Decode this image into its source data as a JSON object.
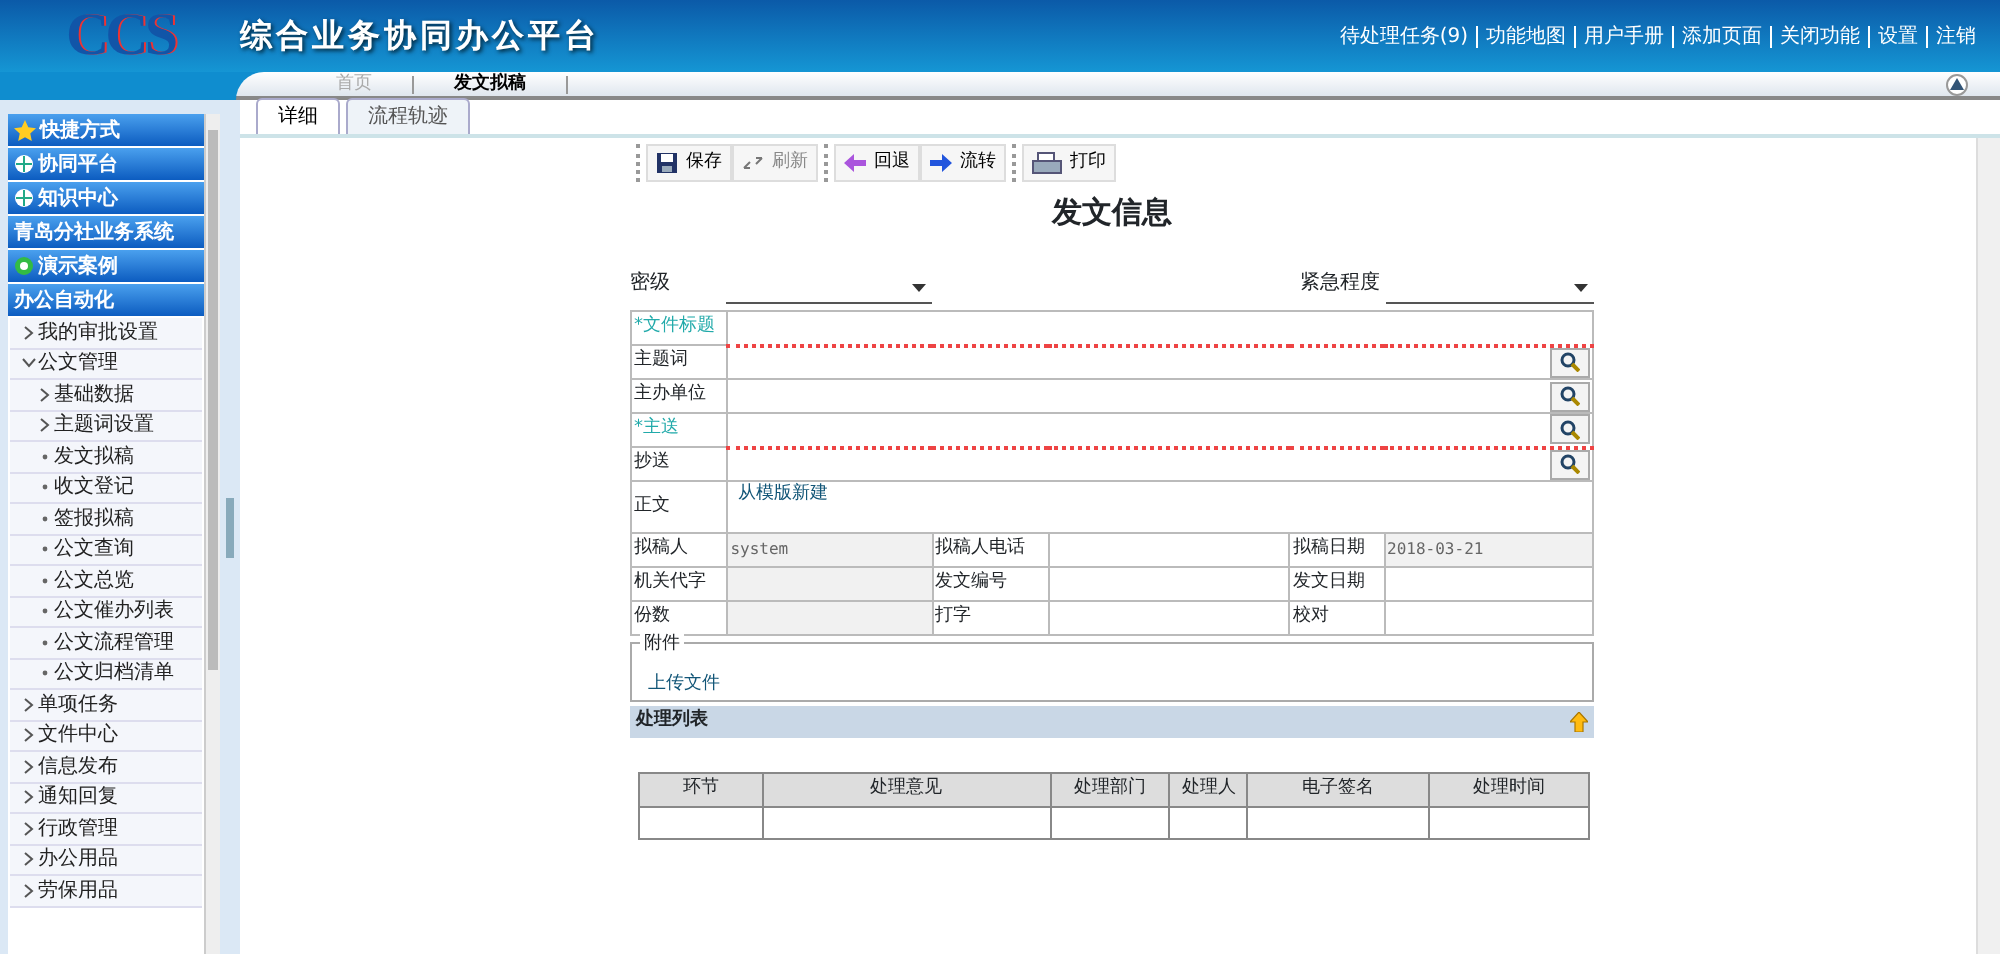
{
  "header": {
    "logo": "CCS",
    "title": "综合业务协同办公平台",
    "links": [
      "待处理任务(9)",
      "功能地图",
      "用户手册",
      "添加页面",
      "关闭功能",
      "设置",
      "注销"
    ]
  },
  "page_tabs": [
    {
      "label": "首页",
      "selected": false
    },
    {
      "label": "发文拟稿",
      "selected": true
    }
  ],
  "sidebar": {
    "sections": [
      {
        "label": "快捷方式"
      },
      {
        "label": "协同平台"
      },
      {
        "label": "知识中心"
      },
      {
        "label": "青岛分社业务系统"
      },
      {
        "label": "演示案例"
      },
      {
        "label": "办公自动化"
      }
    ],
    "items": [
      {
        "label": "我的审批设置",
        "expanded": false
      },
      {
        "label": "公文管理",
        "expanded": true,
        "children": [
          {
            "label": "基础数据",
            "expanded": false
          },
          {
            "label": "主题词设置",
            "expanded": false
          },
          {
            "label": "发文拟稿",
            "kind": "leaf"
          },
          {
            "label": "收文登记",
            "kind": "leaf"
          },
          {
            "label": "签报拟稿",
            "kind": "leaf"
          },
          {
            "label": "公文查询",
            "kind": "leaf"
          },
          {
            "label": "公文总览",
            "kind": "leaf"
          },
          {
            "label": "公文催办列表",
            "kind": "leaf"
          },
          {
            "label": "公文流程管理",
            "kind": "leaf"
          },
          {
            "label": "公文归档清单",
            "kind": "leaf"
          }
        ]
      },
      {
        "label": "单项任务",
        "expanded": false
      },
      {
        "label": "文件中心",
        "expanded": false
      },
      {
        "label": "信息发布",
        "expanded": false
      },
      {
        "label": "通知回复",
        "expanded": false
      },
      {
        "label": "行政管理",
        "expanded": false
      },
      {
        "label": "办公用品",
        "expanded": false
      },
      {
        "label": "劳保用品",
        "expanded": false
      }
    ]
  },
  "content_tabs": [
    {
      "label": "详细",
      "selected": true
    },
    {
      "label": "流程轨迹",
      "selected": false
    }
  ],
  "toolbar": [
    [
      {
        "label": "保存",
        "disabled": false
      },
      {
        "label": "刷新",
        "disabled": true
      }
    ],
    [
      {
        "label": "回退",
        "disabled": false
      },
      {
        "label": "流转",
        "disabled": false
      }
    ],
    [
      {
        "label": "打印",
        "disabled": false
      }
    ]
  ],
  "form": {
    "title": "发文信息",
    "selects": [
      {
        "label": "密级"
      },
      {
        "label": "紧急程度"
      }
    ],
    "rows": [
      {
        "label": "*文件标题",
        "required": true,
        "lookup": false
      },
      {
        "label": "主题词",
        "required": false,
        "lookup": true
      },
      {
        "label": "主办单位",
        "required": false,
        "lookup": true
      },
      {
        "label": "*主送",
        "required": true,
        "lookup": true
      },
      {
        "label": "抄送",
        "required": false,
        "lookup": true
      }
    ],
    "body": {
      "label": "正文",
      "link": "从模版新建"
    },
    "grid": [
      [
        {
          "label": "拟稿人",
          "value": "system",
          "readonly": true
        },
        {
          "label": "拟稿人电话",
          "readonly": false
        },
        {
          "label": "拟稿日期",
          "value": "2018-03-21",
          "readonly": true
        }
      ],
      [
        {
          "label": "机关代字",
          "readonly": true
        },
        {
          "label": "发文编号",
          "readonly": false
        },
        {
          "label": "发文日期",
          "readonly": false
        }
      ],
      [
        {
          "label": "份数",
          "readonly": true
        },
        {
          "label": "打字",
          "readonly": false
        },
        {
          "label": "校对",
          "readonly": false
        }
      ]
    ],
    "attachments": {
      "legend": "附件",
      "link": "上传文件"
    }
  },
  "process": {
    "title": "处理列表",
    "columns": [
      "环节",
      "处理意见",
      "处理部门",
      "处理人",
      "电子签名",
      "处理时间"
    ]
  }
}
